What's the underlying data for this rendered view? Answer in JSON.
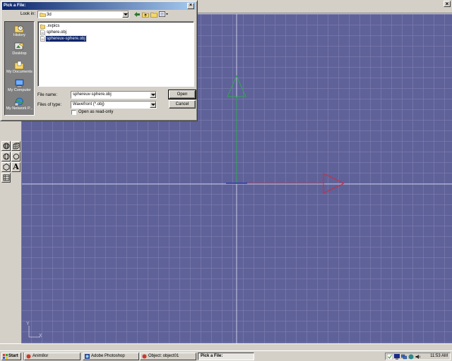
{
  "dialog": {
    "title": "Pick a File:",
    "close_label": "×",
    "look_in_label": "Look in:",
    "look_in_value": "3d",
    "places": [
      {
        "label": "History",
        "icon": "history-icon"
      },
      {
        "label": "Desktop",
        "icon": "desktop-icon"
      },
      {
        "label": "My Documents",
        "icon": "my-documents-icon"
      },
      {
        "label": "My Computer",
        "icon": "my-computer-icon"
      },
      {
        "label": "My Network P...",
        "icon": "my-network-places-icon"
      }
    ],
    "files": [
      {
        "name": ".xvpics",
        "icon": "folder-icon",
        "selected": false
      },
      {
        "name": "sphere.obj",
        "icon": "file-icon",
        "selected": false
      },
      {
        "name": "sphereuv-sphere.obj",
        "icon": "file-icon",
        "selected": true
      }
    ],
    "file_name_label": "File name:",
    "file_name_value": "sphereuv-sphere.obj",
    "file_type_label": "Files of type:",
    "file_type_value": "Wavefront (*.obj)",
    "read_only_label": "Open as read-only",
    "read_only_checked": false,
    "open_label": "Open",
    "cancel_label": "Cancel"
  },
  "app": {
    "close_label": "×"
  },
  "tools": [
    {
      "icon": "sphere-tool-icon"
    },
    {
      "icon": "grid-cube-tool-icon"
    },
    {
      "icon": "cylinder-tool-icon"
    },
    {
      "icon": "blob-tool-icon"
    },
    {
      "icon": "hexagon-tool-icon"
    },
    {
      "label": "A",
      "icon": "text-tool-icon"
    },
    {
      "icon": "grid-tool-icon"
    }
  ],
  "viewport": {
    "axis_y_label": "Y",
    "axis_x_label": "X",
    "colors": {
      "background": "#5f6199",
      "y_axis": "#2fa84f",
      "x_axis": "#d22b3a",
      "z_axis": "#1f2fb8"
    }
  },
  "taskbar": {
    "start_label": "Start",
    "tasks": [
      {
        "label": "Anim8or",
        "active": false,
        "icon": "anim8or-icon"
      },
      {
        "label": "Adobe Photoshop",
        "active": false,
        "icon": "photoshop-icon"
      },
      {
        "label": "Object: object01",
        "active": false,
        "icon": "anim8or-icon"
      },
      {
        "label": "Pick a File:",
        "active": true,
        "icon": ""
      }
    ],
    "clock": "11:53 AM"
  }
}
